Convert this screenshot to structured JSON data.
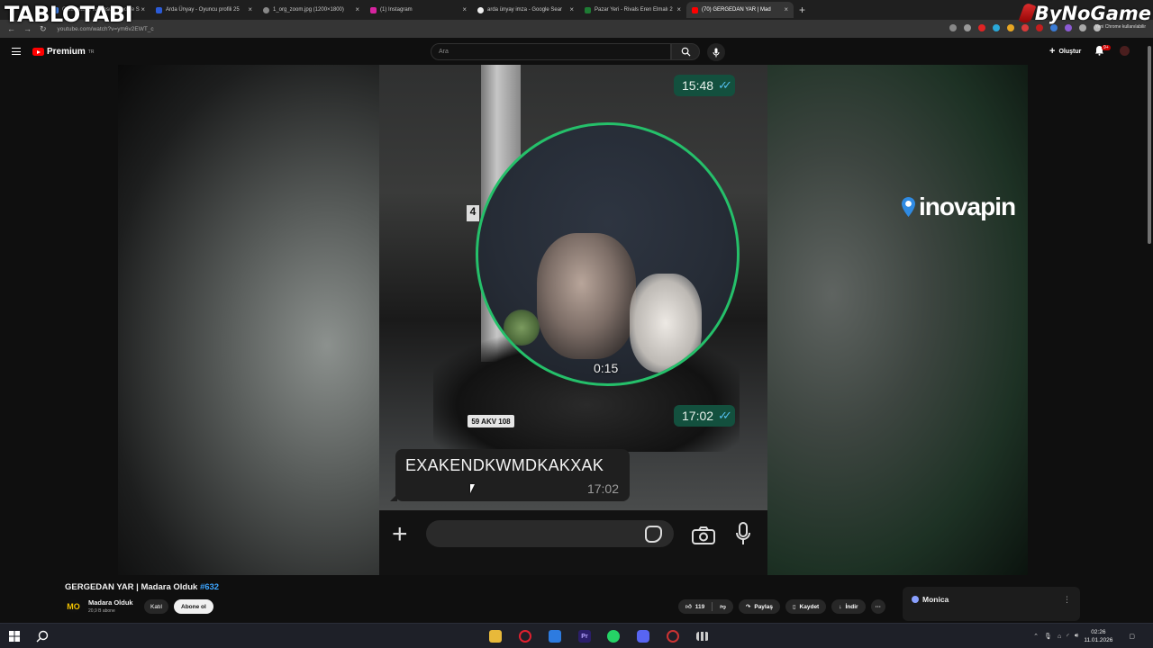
{
  "watermarks": {
    "left": "TABLOTABI",
    "right": "ByNoGame"
  },
  "browser": {
    "tabs": [
      {
        "title": "Galatasaray kadrosu - Google S"
      },
      {
        "title": "Arda Ünyay - Oyuncu profili 25"
      },
      {
        "title": "1_org_zoom.jpg (1200×1800)"
      },
      {
        "title": "(1) Instagram"
      },
      {
        "title": "arda ünyay imza - Google Sear"
      },
      {
        "title": "Pazar Yeri - Rivals Eren Elmalı 2"
      },
      {
        "title": "(70) GERGEDAN YAR | Mad"
      }
    ],
    "new_tab": "+",
    "url": "youtube.com/watch?v=ym6v2EWT_c",
    "profile_text": "Yeni Chrome kullanılabilir"
  },
  "youtube": {
    "logo": "Premium",
    "logo_sup": "TR",
    "search_placeholder": "Ara",
    "create_label": "Oluştur",
    "notif_count": "9+"
  },
  "video": {
    "time_top": "15:48",
    "plate": "59 AKV 108",
    "circle_time": "0:15",
    "time_mid": "17:02",
    "message_text": "EXAKENDKWMDKAKXAK",
    "message_time": "17:02",
    "pillar_number": "4",
    "sponsor": "inovapin"
  },
  "info": {
    "title": "GERGEDAN YAR | Madara Olduk",
    "title_tag": "#632",
    "channel_logo": "MO",
    "channel_name": "Madara Olduk",
    "subscribers": "20,9 B abone",
    "join_label": "Katıl",
    "subscribe_label": "Abone ol",
    "likes": "119",
    "share_label": "Paylaş",
    "save_label": "Kaydet",
    "download_label": "İndir",
    "more_label": "···"
  },
  "monica": {
    "label": "Monica",
    "menu": "⋮"
  },
  "taskbar": {
    "time": "02:26",
    "date": "11.01.2026"
  },
  "colors": {
    "accent_green": "#25c06a",
    "chat_green": "#13503e",
    "yt_red": "#ff0000",
    "link_blue": "#3ea6ff"
  }
}
